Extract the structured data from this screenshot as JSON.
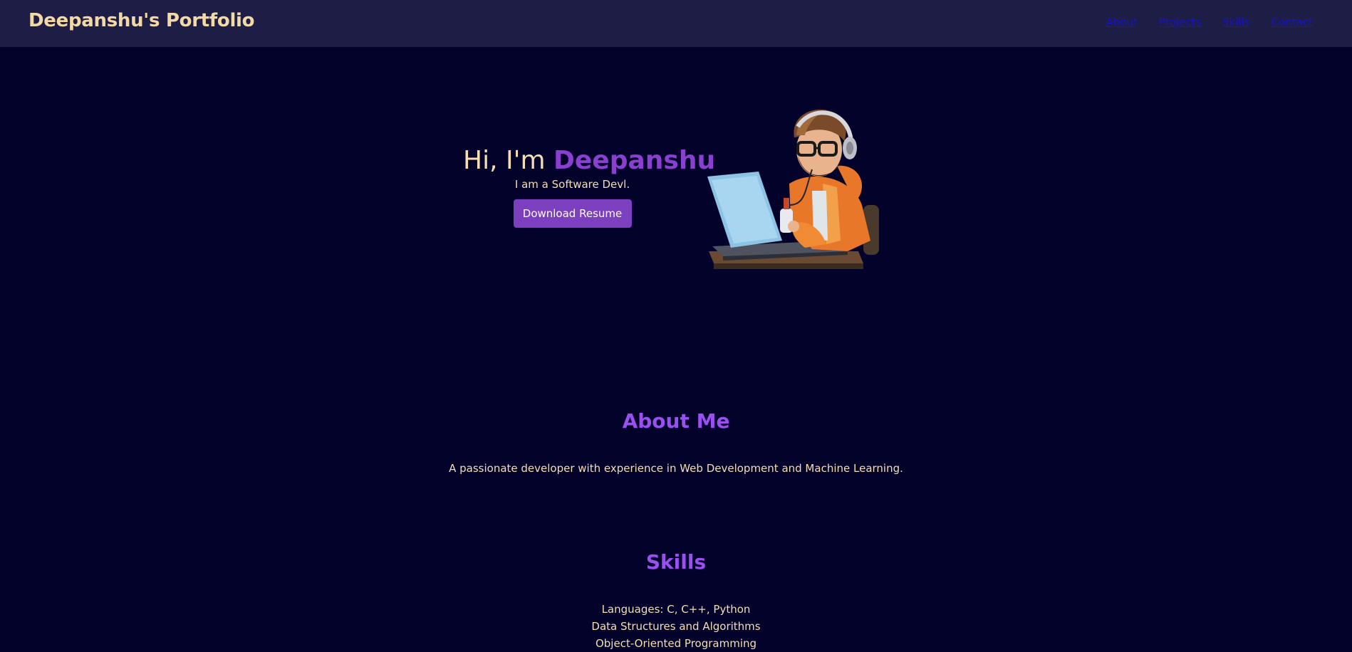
{
  "header": {
    "brand": "Deepanshu's Portfolio",
    "nav": [
      "About",
      "Projects",
      "Skills",
      "Contact"
    ]
  },
  "hero": {
    "greeting": "Hi, I'm",
    "name": "Deepanshu",
    "subtitle": "I am a Software Devl.",
    "cta_label": "Download Resume",
    "image_icon": "developer-avatar-illustration"
  },
  "about": {
    "title": "About Me",
    "text": "A passionate developer with experience in Web Development and Machine Learning."
  },
  "skills": {
    "title": "Skills",
    "items": [
      "Languages: C, C++, Python",
      "Data Structures and Algorithms",
      "Object-Oriented Programming"
    ]
  },
  "colors": {
    "background": "#03022a",
    "navbar": "#1e1d45",
    "accent": "#8a3fd0",
    "text": "#f5deb3",
    "link": "#1414c8"
  }
}
